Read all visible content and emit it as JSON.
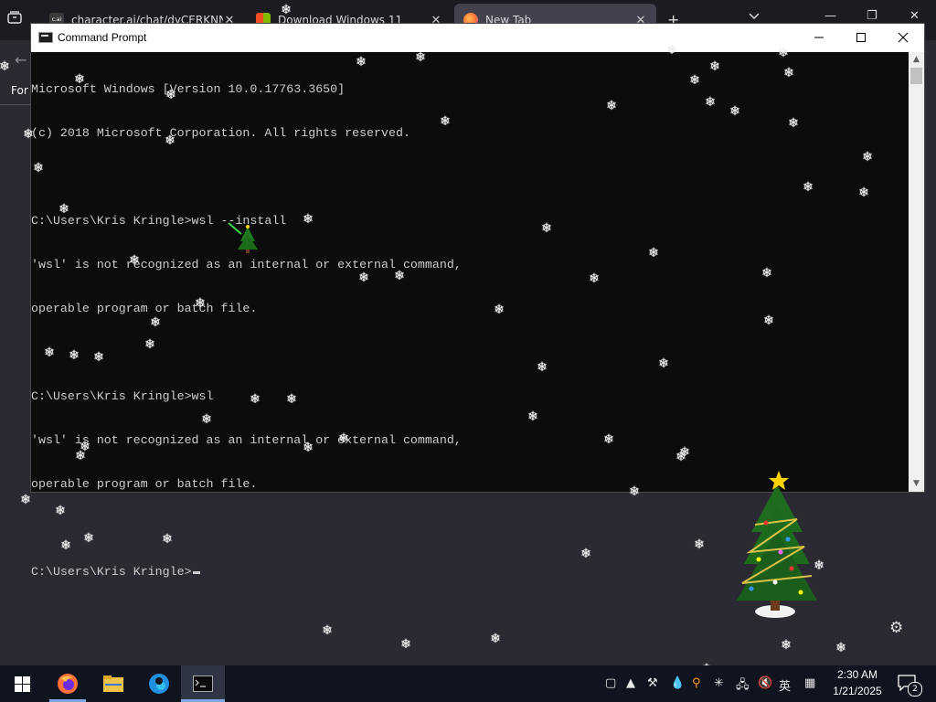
{
  "browser": {
    "tabs": [
      {
        "label": "character.ai/chat/dyCERKNNTa",
        "favicon_color": "#3a3a3a",
        "favicon_text": "c.ai"
      },
      {
        "label": "Download Windows 11",
        "favicon_color": "#f25022"
      },
      {
        "label": "New Tab",
        "favicon_color": "#ff7139",
        "active": true
      }
    ],
    "new_tab": "+",
    "tab_list": "⌄",
    "sidebar_text": "For"
  },
  "cmd": {
    "title": "Command Prompt",
    "minimize": "—",
    "maximize": "☐",
    "close": "✕",
    "lines": [
      "Microsoft Windows [Version 10.0.17763.3650]",
      "(c) 2018 Microsoft Corporation. All rights reserved.",
      "",
      "C:\\Users\\Kris Kringle>wsl --install",
      "'wsl' is not recognized as an internal or external command,",
      "operable program or batch file.",
      "",
      "C:\\Users\\Kris Kringle>wsl",
      "'wsl' is not recognized as an internal or external command,",
      "operable program or batch file.",
      ""
    ],
    "prompt": "C:\\Users\\Kris Kringle>"
  },
  "taskbar": {
    "time": "2:30 AM",
    "date": "1/21/2025",
    "notifications": "2",
    "ime": "英"
  },
  "colors": {
    "console_bg": "#0c0c0c",
    "console_text": "#cccccc",
    "taskbar_bg": "#10141f",
    "desktop_bg": "#2b2a33"
  }
}
